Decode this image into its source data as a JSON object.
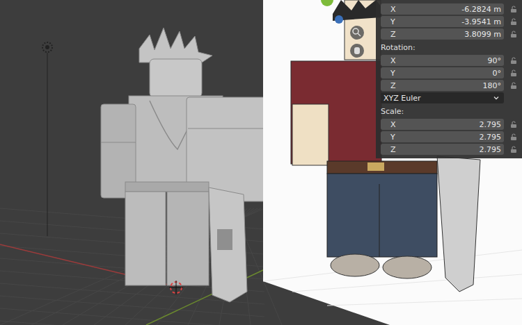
{
  "panel": {
    "sections": [
      {
        "label": "",
        "fields": [
          {
            "axis": "X",
            "value": "-6.2824 m",
            "locked": false
          },
          {
            "axis": "Y",
            "value": "-3.9541 m",
            "locked": false
          },
          {
            "axis": "Z",
            "value": "3.8099 m",
            "locked": false
          }
        ]
      },
      {
        "label": "Rotation:",
        "fields": [
          {
            "axis": "X",
            "value": "90°",
            "locked": false
          },
          {
            "axis": "Y",
            "value": "0°",
            "locked": false
          },
          {
            "axis": "Z",
            "value": "180°",
            "locked": false
          }
        ],
        "mode": "XYZ Euler"
      },
      {
        "label": "Scale:",
        "fields": [
          {
            "axis": "X",
            "value": "2.795",
            "locked": false
          },
          {
            "axis": "Y",
            "value": "2.795",
            "locked": false
          },
          {
            "axis": "Z",
            "value": "2.795",
            "locked": false
          }
        ]
      }
    ]
  }
}
